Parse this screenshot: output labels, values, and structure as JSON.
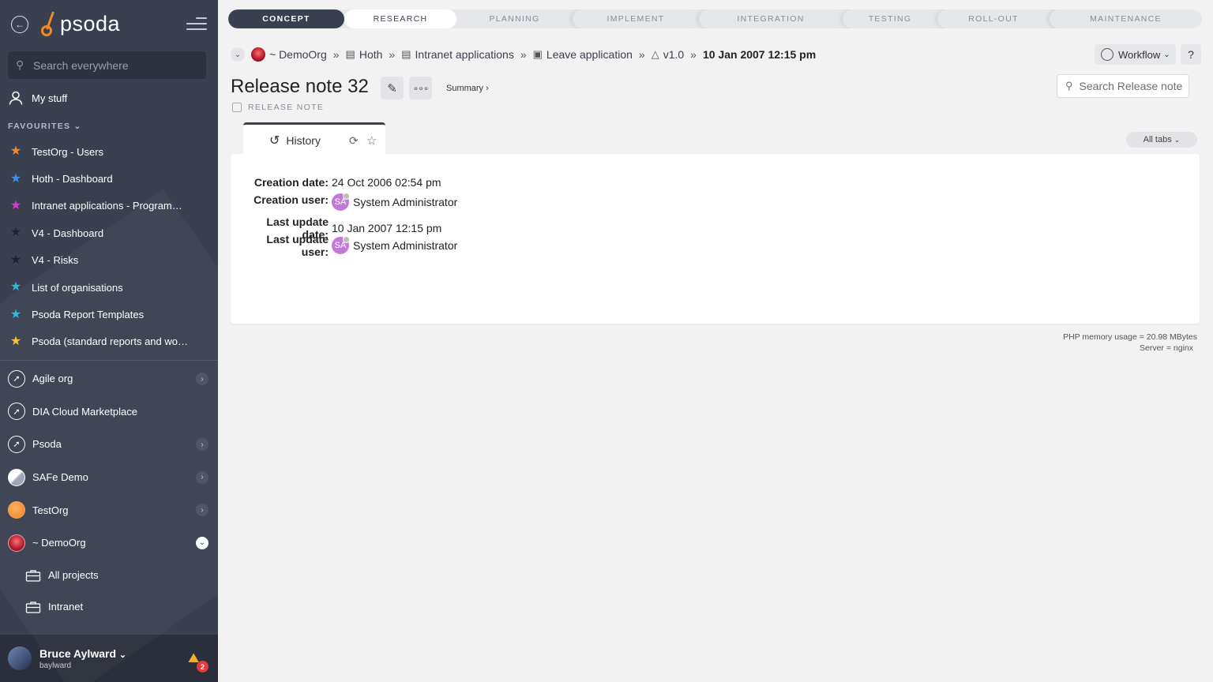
{
  "sidebar": {
    "logo_text": "psoda",
    "search_placeholder": "Search everywhere",
    "my_stuff": "My stuff",
    "favourites_heading": "FAVOURITES",
    "favourites": [
      {
        "label": "TestOrg - Users",
        "color": "#f08a24"
      },
      {
        "label": "Hoth - Dashboard",
        "color": "#3f8ee8"
      },
      {
        "label": "Intranet applications - Programme...",
        "color": "#d23ec9"
      },
      {
        "label": "V4 - Dashboard",
        "color": "#1f2230"
      },
      {
        "label": "V4 - Risks",
        "color": "#1f2230"
      },
      {
        "label": "List of organisations",
        "color": "#2bb6d8"
      },
      {
        "label": "Psoda Report Templates",
        "color": "#2bb6d8"
      },
      {
        "label": "Psoda (standard reports and work...",
        "color": "#f0c030"
      }
    ],
    "orgs": [
      {
        "label": "Agile org",
        "expand": true
      },
      {
        "label": "DIA Cloud Marketplace",
        "expand": false
      },
      {
        "label": "Psoda",
        "expand": true
      },
      {
        "label": "SAFe Demo",
        "expand": true
      },
      {
        "label": "TestOrg",
        "expand": true
      },
      {
        "label": "~ DemoOrg",
        "expand": true
      }
    ],
    "sub_items": [
      "All projects",
      "Intranet"
    ],
    "user": {
      "name": "Bruce Aylward",
      "username": "baylward",
      "notifications": "2"
    }
  },
  "phases": [
    "CONCEPT",
    "RESEARCH",
    "PLANNING",
    "IMPLEMENT",
    "INTEGRATION",
    "TESTING",
    "ROLL-OUT",
    "MAINTENANCE"
  ],
  "breadcrumbs": [
    "~ DemoOrg",
    "Hoth",
    "Intranet applications",
    "Leave application",
    "v1.0",
    "10 Jan 2007 12:15 pm"
  ],
  "header": {
    "workflow_label": "Workflow",
    "help_label": "?",
    "title": "Release note 32",
    "summary_link": "Summary ›",
    "type_label": "RELEASE NOTE",
    "search_placeholder": "Search Release note"
  },
  "tabs": {
    "active": "History",
    "all_tabs": "All tabs"
  },
  "history": {
    "creation_date_label": "Creation date:",
    "creation_date": "24 Oct 2006 02:54 pm",
    "creation_user_label": "Creation user:",
    "creation_user": "System Administrator",
    "last_update_date_label": "Last update date:",
    "last_update_date": "10 Jan 2007 12:15 pm",
    "last_update_user_label": "Last update user:",
    "last_update_user": "System Administrator",
    "user_initials": "SA"
  },
  "footer": {
    "memory": "PHP memory usage = 20.98 MBytes",
    "server": "Server = nginx"
  }
}
